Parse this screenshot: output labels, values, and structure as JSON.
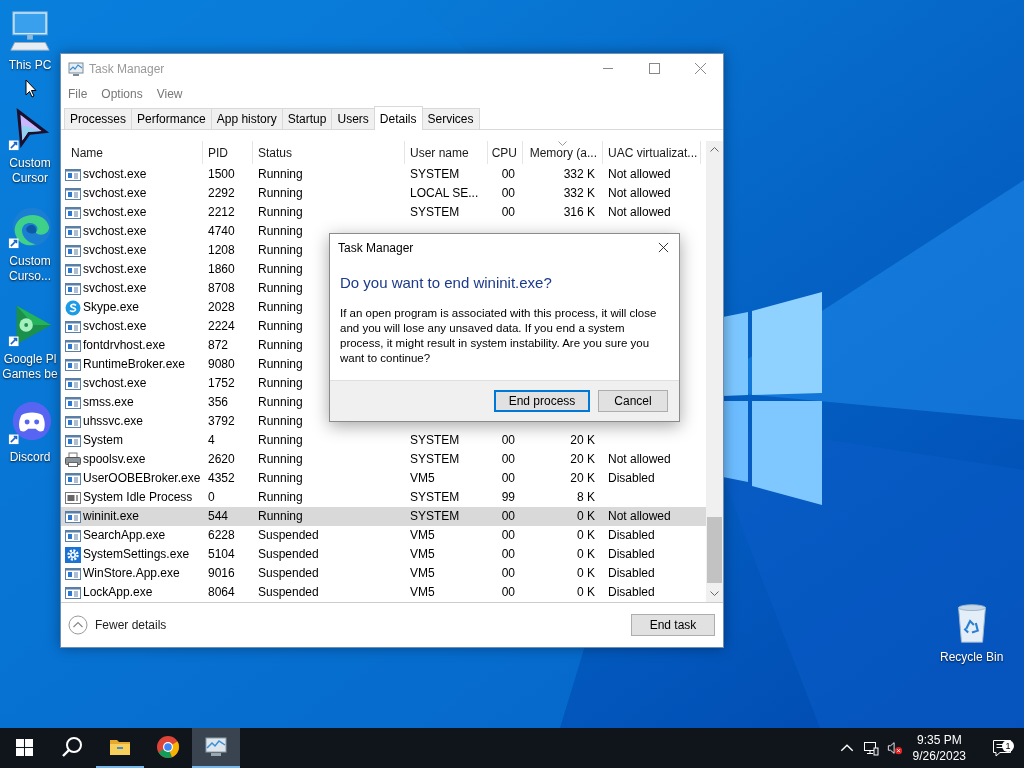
{
  "desktop_icons": [
    {
      "kind": "pc",
      "label": "This PC"
    },
    {
      "kind": "cursor",
      "label": "Custom Cursor"
    },
    {
      "kind": "swirl",
      "label": "Custom Curso..."
    },
    {
      "kind": "games",
      "label": "Google Pl Games be"
    },
    {
      "kind": "discord",
      "label": "Discord"
    }
  ],
  "recycle_bin": {
    "label": "Recycle Bin"
  },
  "task_manager": {
    "title": "Task Manager",
    "menu": [
      "File",
      "Options",
      "View"
    ],
    "tabs": [
      {
        "label": "Processes",
        "selected": false
      },
      {
        "label": "Performance",
        "selected": false
      },
      {
        "label": "App history",
        "selected": false
      },
      {
        "label": "Startup",
        "selected": false
      },
      {
        "label": "Users",
        "selected": false
      },
      {
        "label": "Details",
        "selected": true
      },
      {
        "label": "Services",
        "selected": false
      }
    ],
    "columns": [
      {
        "label": "Name",
        "sorted": false
      },
      {
        "label": "PID",
        "sorted": false
      },
      {
        "label": "Status",
        "sorted": false
      },
      {
        "label": "User name",
        "sorted": false
      },
      {
        "label": "CPU",
        "sorted": false
      },
      {
        "label": "Memory (a...",
        "sorted": true
      },
      {
        "label": "UAC virtualizat...",
        "sorted": false
      }
    ],
    "rows": [
      {
        "kind": "app",
        "name": "svchost.exe",
        "pid": "1500",
        "status": "Running",
        "user": "SYSTEM",
        "cpu": "00",
        "memory": "332 K",
        "uac": "Not allowed",
        "selected": false
      },
      {
        "kind": "app",
        "name": "svchost.exe",
        "pid": "2292",
        "status": "Running",
        "user": "LOCAL SE...",
        "cpu": "00",
        "memory": "332 K",
        "uac": "Not allowed",
        "selected": false
      },
      {
        "kind": "app",
        "name": "svchost.exe",
        "pid": "2212",
        "status": "Running",
        "user": "SYSTEM",
        "cpu": "00",
        "memory": "316 K",
        "uac": "Not allowed",
        "selected": false
      },
      {
        "kind": "app",
        "name": "svchost.exe",
        "pid": "4740",
        "status": "Running",
        "selected": false
      },
      {
        "kind": "app",
        "name": "svchost.exe",
        "pid": "1208",
        "status": "Running",
        "selected": false
      },
      {
        "kind": "app",
        "name": "svchost.exe",
        "pid": "1860",
        "status": "Running",
        "selected": false
      },
      {
        "kind": "app",
        "name": "svchost.exe",
        "pid": "8708",
        "status": "Running",
        "selected": false
      },
      {
        "kind": "skype",
        "name": "Skype.exe",
        "pid": "2028",
        "status": "Running",
        "selected": false
      },
      {
        "kind": "app",
        "name": "svchost.exe",
        "pid": "2224",
        "status": "Running",
        "selected": false
      },
      {
        "kind": "app",
        "name": "fontdrvhost.exe",
        "pid": "872",
        "status": "Running",
        "selected": false
      },
      {
        "kind": "app",
        "name": "RuntimeBroker.exe",
        "pid": "9080",
        "status": "Running",
        "selected": false
      },
      {
        "kind": "app",
        "name": "svchost.exe",
        "pid": "1752",
        "status": "Running",
        "selected": false
      },
      {
        "kind": "app",
        "name": "smss.exe",
        "pid": "356",
        "status": "Running",
        "selected": false
      },
      {
        "kind": "app",
        "name": "uhssvc.exe",
        "pid": "3792",
        "status": "Running",
        "selected": false
      },
      {
        "kind": "app",
        "name": "System",
        "pid": "4",
        "status": "Running",
        "user": "SYSTEM",
        "cpu": "00",
        "memory": "20 K",
        "selected": false
      },
      {
        "kind": "printer",
        "name": "spoolsv.exe",
        "pid": "2620",
        "status": "Running",
        "user": "SYSTEM",
        "cpu": "00",
        "memory": "20 K",
        "uac": "Not allowed",
        "selected": false
      },
      {
        "kind": "app",
        "name": "UserOOBEBroker.exe",
        "pid": "4352",
        "status": "Running",
        "user": "VM5",
        "cpu": "00",
        "memory": "20 K",
        "uac": "Disabled",
        "selected": false
      },
      {
        "kind": "idle",
        "name": "System Idle Process",
        "pid": "0",
        "status": "Running",
        "user": "SYSTEM",
        "cpu": "99",
        "memory": "8 K",
        "selected": false
      },
      {
        "kind": "app",
        "name": "wininit.exe",
        "pid": "544",
        "status": "Running",
        "user": "SYSTEM",
        "cpu": "00",
        "memory": "0 K",
        "uac": "Not allowed",
        "selected": true
      },
      {
        "kind": "app",
        "name": "SearchApp.exe",
        "pid": "6228",
        "status": "Suspended",
        "user": "VM5",
        "cpu": "00",
        "memory": "0 K",
        "uac": "Disabled",
        "selected": false
      },
      {
        "kind": "gear",
        "name": "SystemSettings.exe",
        "pid": "5104",
        "status": "Suspended",
        "user": "VM5",
        "cpu": "00",
        "memory": "0 K",
        "uac": "Disabled",
        "selected": false
      },
      {
        "kind": "app",
        "name": "WinStore.App.exe",
        "pid": "9016",
        "status": "Suspended",
        "user": "VM5",
        "cpu": "00",
        "memory": "0 K",
        "uac": "Disabled",
        "selected": false
      },
      {
        "kind": "app",
        "name": "LockApp.exe",
        "pid": "8064",
        "status": "Suspended",
        "user": "VM5",
        "cpu": "00",
        "memory": "0 K",
        "uac": "Disabled",
        "selected": false
      }
    ],
    "footer": {
      "toggle": "Fewer details",
      "end_task": "End task"
    }
  },
  "dialog": {
    "title": "Task Manager",
    "heading": "Do you want to end wininit.exe?",
    "message": "If an open program is associated with this process, it will close and you will lose any unsaved data. If you end a system process, it might result in system instability. Are you sure you want to continue?",
    "buttons": [
      {
        "label": "End process",
        "default": true
      },
      {
        "label": "Cancel",
        "default": false
      }
    ]
  },
  "taskbar": {
    "apps": [
      {
        "kind": "explorer",
        "running": true,
        "active": false
      },
      {
        "kind": "chrome",
        "running": false,
        "active": false
      },
      {
        "kind": "taskmgr",
        "running": true,
        "active": true
      }
    ],
    "time": "9:35 PM",
    "date": "9/26/2023",
    "notifications": "1"
  }
}
